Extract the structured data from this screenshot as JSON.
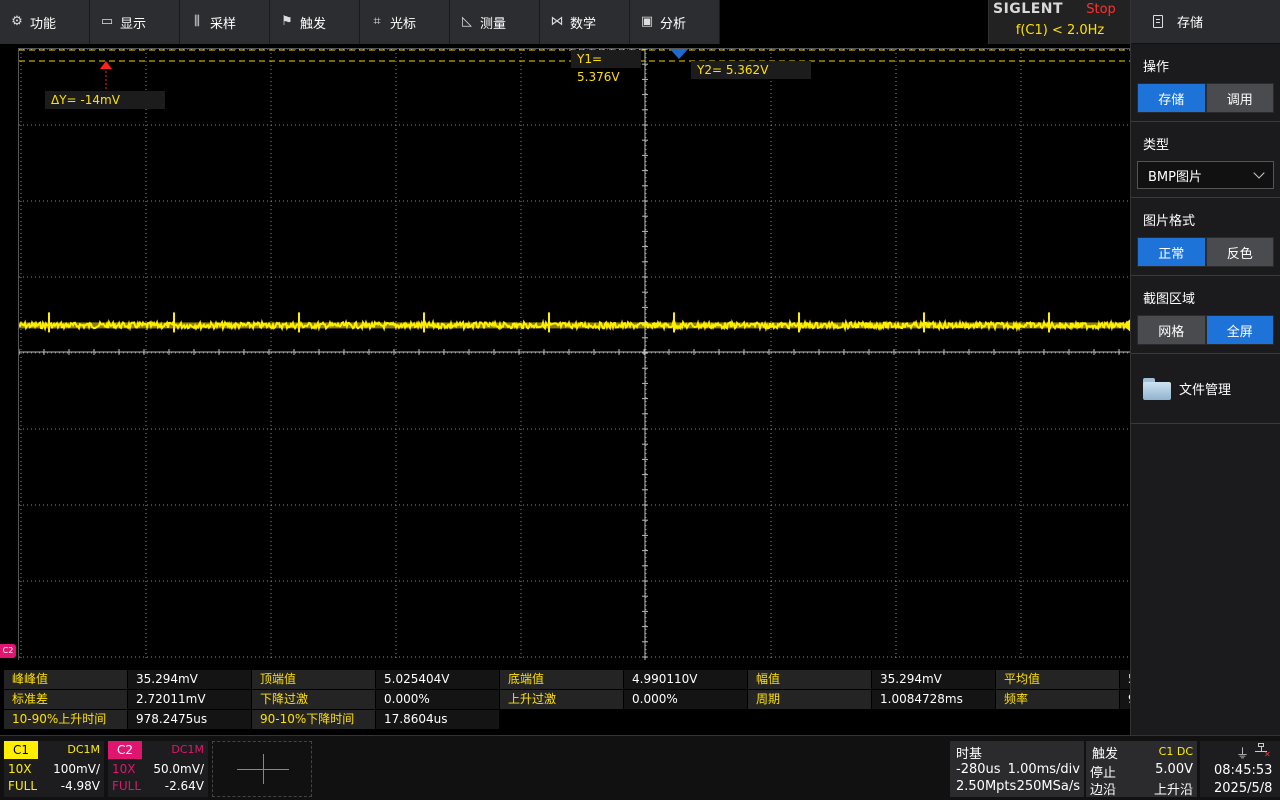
{
  "menu": [
    {
      "label": "功能",
      "icon": "gear-icon",
      "glyph": "⚙"
    },
    {
      "label": "显示",
      "icon": "monitor-icon",
      "glyph": "▭"
    },
    {
      "label": "采样",
      "icon": "sampling-icon",
      "glyph": "⫼"
    },
    {
      "label": "触发",
      "icon": "flag-icon",
      "glyph": "⚑"
    },
    {
      "label": "光标",
      "icon": "crosshair-icon",
      "glyph": "⌗"
    },
    {
      "label": "测量",
      "icon": "ruler-icon",
      "glyph": "◺"
    },
    {
      "label": "数学",
      "icon": "math-icon",
      "glyph": "⋈"
    },
    {
      "label": "分析",
      "icon": "analysis-icon",
      "glyph": "▣"
    }
  ],
  "brand": {
    "logo": "SIGLENT",
    "status": "Stop",
    "trigger_freq": "f(C1) < 2.0Hz"
  },
  "panel": {
    "title": "存储",
    "op_title": "操作",
    "op_buttons": [
      "存储",
      "调用"
    ],
    "type_title": "类型",
    "type_value": "BMP图片",
    "format_title": "图片格式",
    "format_buttons": [
      "正常",
      "反色"
    ],
    "area_title": "截图区域",
    "area_buttons": [
      "网格",
      "全屏"
    ],
    "file_mgr": "文件管理"
  },
  "cursors": {
    "y1": "Y1= 5.376V",
    "y2": "Y2= 5.362V",
    "dy": "ΔY= -14mV"
  },
  "waveform": {
    "color": "#ffee00",
    "spike_period_divs": 1.0,
    "level_div_offset": 0.35
  },
  "c2_marker": "C2",
  "measurements": [
    [
      "峰峰值",
      "35.294mV",
      "顶端值",
      "5.025404V",
      "底端值",
      "4.990110V",
      "幅值",
      "35.294mV",
      "平均值",
      "5"
    ],
    [
      "标准差",
      "2.72011mV",
      "下降过激",
      "0.000%",
      "上升过激",
      "0.000%",
      "周期",
      "1.0084728ms",
      "频率",
      "9"
    ],
    [
      "10-90%上升时间",
      "978.2475us",
      "90-10%下降时间",
      "17.8604us"
    ]
  ],
  "channels": {
    "c1": {
      "tag": "C1",
      "coupling": "DC1M",
      "probe": "10X",
      "scale": "100mV/",
      "bw": "FULL",
      "offset": "-4.98V",
      "color": "#ffee00"
    },
    "c2": {
      "tag": "C2",
      "coupling": "DC1M",
      "probe": "10X",
      "scale": "50.0mV/",
      "bw": "FULL",
      "offset": "-2.64V",
      "color": "#e0156f"
    }
  },
  "timebase": {
    "title": "时基",
    "delay": "-280us",
    "scale": "1.00ms/div",
    "depth": "2.50Mpts",
    "rate": "250MSa/s"
  },
  "trigger": {
    "title": "触发",
    "source": "C1 DC",
    "mode": "停止",
    "level": "5.00V",
    "type": "边沿",
    "slope": "上升沿"
  },
  "clock": {
    "time": "08:45:53",
    "date": "2025/5/8"
  }
}
